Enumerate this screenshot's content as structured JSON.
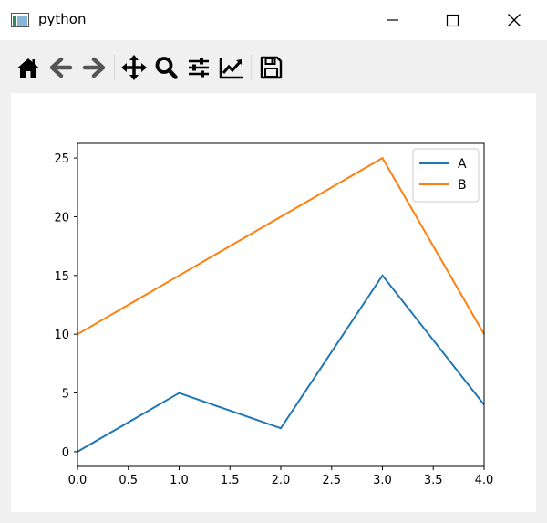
{
  "window": {
    "title": "python",
    "app_icon": "python-window-icon",
    "controls": [
      "minimize-icon",
      "maximize-icon",
      "close-icon"
    ]
  },
  "toolbar": {
    "tools": [
      {
        "name": "home-button",
        "icon": "home-icon"
      },
      {
        "name": "back-button",
        "icon": "arrow-left-icon"
      },
      {
        "name": "forward-button",
        "icon": "arrow-right-icon"
      },
      {
        "name": "pan-button",
        "icon": "move-arrows-icon"
      },
      {
        "name": "zoom-button",
        "icon": "magnifier-icon"
      },
      {
        "name": "subplots-button",
        "icon": "sliders-icon"
      },
      {
        "name": "axes-edit-button",
        "icon": "line-chart-icon"
      },
      {
        "name": "save-button",
        "icon": "floppy-disk-icon"
      }
    ]
  },
  "chart_data": {
    "type": "line",
    "x": [
      0,
      1,
      2,
      3,
      4
    ],
    "series": [
      {
        "name": "A",
        "values": [
          0,
          5,
          2,
          15,
          4
        ],
        "color": "#1f77b4"
      },
      {
        "name": "B",
        "values": [
          10,
          15,
          20,
          25,
          10
        ],
        "color": "#ff7f0e"
      }
    ],
    "xlim": [
      0,
      4
    ],
    "ylim": [
      -1.25,
      26.25
    ],
    "xticks": [
      "0.0",
      "0.5",
      "1.0",
      "1.5",
      "2.0",
      "2.5",
      "3.0",
      "3.5",
      "4.0"
    ],
    "yticks": [
      "0",
      "5",
      "10",
      "15",
      "20",
      "25"
    ],
    "legend": "top-right",
    "grid": false
  }
}
